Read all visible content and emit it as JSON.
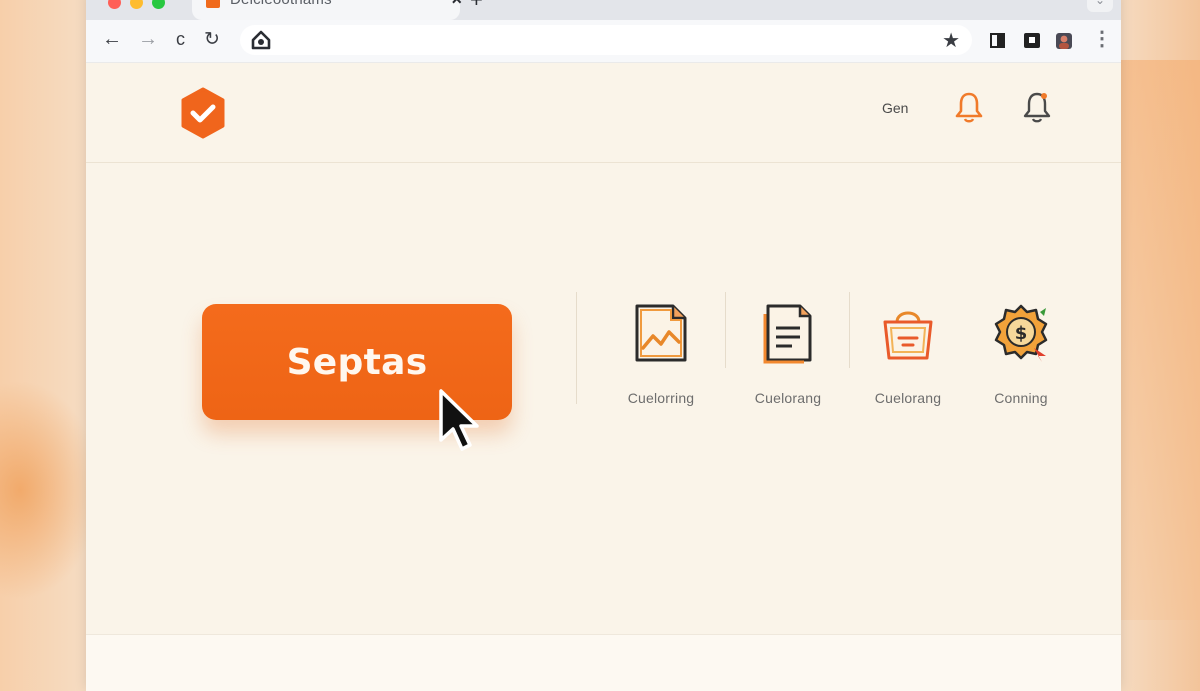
{
  "browser": {
    "tab": {
      "title": "Deicleoothams",
      "close_glyph": "×",
      "favicon_icon": "orange-square-favicon"
    },
    "new_tab_glyph": "+",
    "tab_menu_glyph": "⌄",
    "nav": {
      "back_glyph": "←",
      "forward_glyph": "→",
      "extra_glyph": "c",
      "reload_glyph": "↻"
    },
    "address": {
      "value": "",
      "icon": "home-icon"
    },
    "star_glyph": "★",
    "menu_glyph": "⋮",
    "traffic_colors": [
      "#ff5f57",
      "#febc2e",
      "#28c840"
    ]
  },
  "header": {
    "logo_icon": "hexagon-check-logo",
    "text": "Gen",
    "bell_colors": [
      "#f07a2a",
      "#4a4a4a"
    ]
  },
  "main": {
    "cta_label": "Septas",
    "accent": "#f26a1b",
    "features": [
      {
        "label": "Cuelorring",
        "icon": "chart-document-icon"
      },
      {
        "label": "Cuelorang",
        "icon": "document-icon"
      },
      {
        "label": "Cuelorang",
        "icon": "shopping-bag-icon"
      },
      {
        "label": "Conning",
        "icon": "dollar-badge-icon"
      }
    ]
  }
}
